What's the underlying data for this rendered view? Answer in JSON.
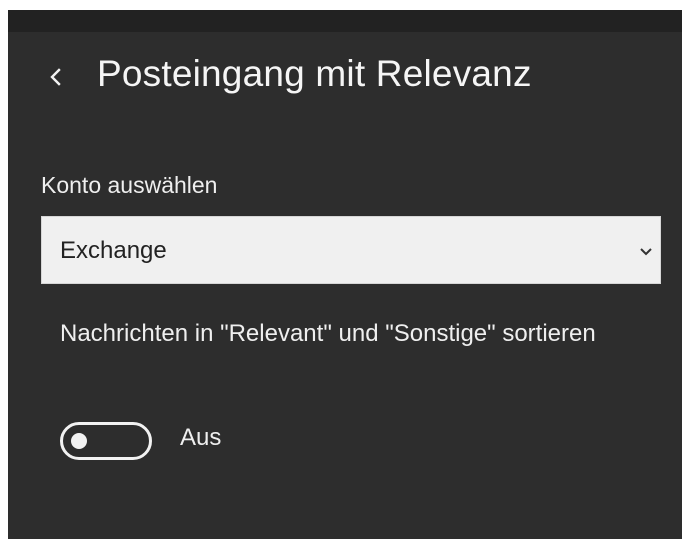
{
  "header": {
    "back_icon": "chevron-left-icon",
    "title": "Posteingang mit Relevanz"
  },
  "account": {
    "label": "Konto auswählen",
    "selected": "Exchange",
    "dropdown_icon": "chevron-down-icon"
  },
  "focused_inbox": {
    "label": "Nachrichten in \"Relevant\" und \"Sonstige\" sortieren",
    "toggle_on": false,
    "toggle_state_label": "Aus"
  },
  "colors": {
    "panel_background": "#2d2d2d",
    "top_strip": "#222222",
    "select_background": "#f0f0f0",
    "text": "#f2f2f2"
  }
}
